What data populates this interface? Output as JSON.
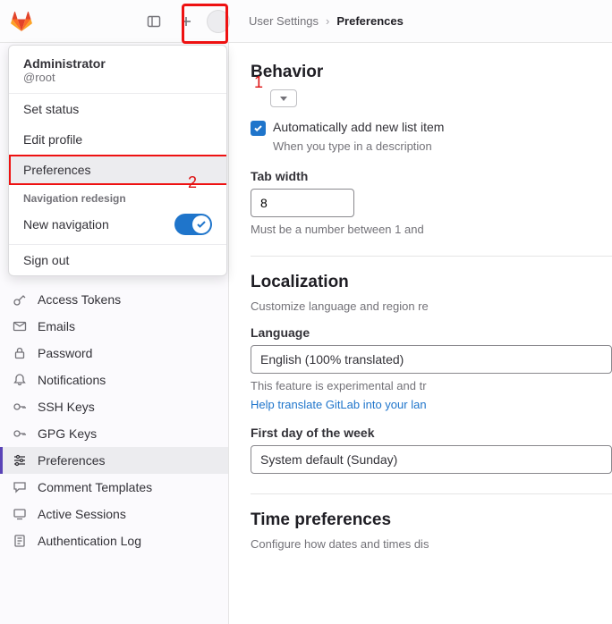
{
  "breadcrumb": {
    "parent": "User Settings",
    "current": "Preferences"
  },
  "annotations": {
    "a1": "1",
    "a2": "2"
  },
  "dropdown": {
    "name": "Administrator",
    "handle": "@root",
    "items": {
      "set_status": "Set status",
      "edit_profile": "Edit profile",
      "preferences": "Preferences",
      "section": "Navigation redesign",
      "new_nav": "New navigation",
      "sign_out": "Sign out"
    }
  },
  "sidebar": {
    "access_tokens": "Access Tokens",
    "emails": "Emails",
    "password": "Password",
    "notifications": "Notifications",
    "ssh": "SSH Keys",
    "gpg": "GPG Keys",
    "preferences": "Preferences",
    "comment_templates": "Comment Templates",
    "active_sessions": "Active Sessions",
    "auth_log": "Authentication Log"
  },
  "content": {
    "behavior_h": "Behavior",
    "checkbox_label": "Automatically add new list item",
    "checkbox_hint": "When you type in a description",
    "tab_width_label": "Tab width",
    "tab_width_value": "8",
    "tab_width_hint": "Must be a number between 1 and ",
    "localization_h": "Localization",
    "localization_sub": "Customize language and region re",
    "language_label": "Language",
    "language_value": "English (100% translated)",
    "language_hint": "This feature is experimental and tr",
    "language_link": "Help translate GitLab into your lan",
    "first_day_label": "First day of the week",
    "first_day_value": "System default (Sunday)",
    "time_h": "Time preferences",
    "time_sub": "Configure how dates and times dis"
  }
}
